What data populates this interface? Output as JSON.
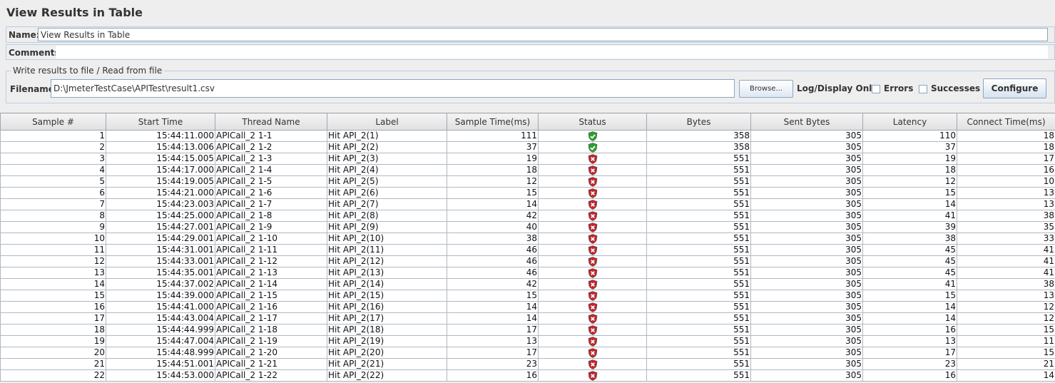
{
  "title": "View Results in Table",
  "name_label": "Name:",
  "name_value": "View Results in Table",
  "comments_label": "Comments:",
  "file_section": {
    "legend": "Write results to file / Read from file",
    "filename_label": "Filename",
    "filename_value": "D:\\JmeterTestCase\\APITest\\result1.csv",
    "browse_label": "Browse...",
    "log_display_label": "Log/Display Only:",
    "errors_label": "Errors",
    "successes_label": "Successes",
    "configure_label": "Configure"
  },
  "table": {
    "columns": [
      "Sample #",
      "Start Time",
      "Thread Name",
      "Label",
      "Sample Time(ms)",
      "Status",
      "Bytes",
      "Sent Bytes",
      "Latency",
      "Connect Time(ms)"
    ],
    "status_colors": {
      "success": "#2e9e2e",
      "error": "#c0272d"
    },
    "rows": [
      {
        "sample": "1",
        "start": "15:44:11.000",
        "thread": "APICall_2 1-1",
        "label": "Hit API_2(1)",
        "time": "111",
        "status": "success",
        "bytes": "358",
        "sent": "305",
        "latency": "110",
        "connect": "18"
      },
      {
        "sample": "2",
        "start": "15:44:13.006",
        "thread": "APICall_2 1-2",
        "label": "Hit API_2(2)",
        "time": "37",
        "status": "success",
        "bytes": "358",
        "sent": "305",
        "latency": "37",
        "connect": "18"
      },
      {
        "sample": "3",
        "start": "15:44:15.005",
        "thread": "APICall_2 1-3",
        "label": "Hit API_2(3)",
        "time": "19",
        "status": "error",
        "bytes": "551",
        "sent": "305",
        "latency": "19",
        "connect": "17"
      },
      {
        "sample": "4",
        "start": "15:44:17.000",
        "thread": "APICall_2 1-4",
        "label": "Hit API_2(4)",
        "time": "18",
        "status": "error",
        "bytes": "551",
        "sent": "305",
        "latency": "18",
        "connect": "16"
      },
      {
        "sample": "5",
        "start": "15:44:19.005",
        "thread": "APICall_2 1-5",
        "label": "Hit API_2(5)",
        "time": "12",
        "status": "error",
        "bytes": "551",
        "sent": "305",
        "latency": "12",
        "connect": "10"
      },
      {
        "sample": "6",
        "start": "15:44:21.000",
        "thread": "APICall_2 1-6",
        "label": "Hit API_2(6)",
        "time": "15",
        "status": "error",
        "bytes": "551",
        "sent": "305",
        "latency": "15",
        "connect": "13"
      },
      {
        "sample": "7",
        "start": "15:44:23.003",
        "thread": "APICall_2 1-7",
        "label": "Hit API_2(7)",
        "time": "14",
        "status": "error",
        "bytes": "551",
        "sent": "305",
        "latency": "14",
        "connect": "13"
      },
      {
        "sample": "8",
        "start": "15:44:25.000",
        "thread": "APICall_2 1-8",
        "label": "Hit API_2(8)",
        "time": "42",
        "status": "error",
        "bytes": "551",
        "sent": "305",
        "latency": "41",
        "connect": "38"
      },
      {
        "sample": "9",
        "start": "15:44:27.001",
        "thread": "APICall_2 1-9",
        "label": "Hit API_2(9)",
        "time": "40",
        "status": "error",
        "bytes": "551",
        "sent": "305",
        "latency": "39",
        "connect": "35"
      },
      {
        "sample": "10",
        "start": "15:44:29.001",
        "thread": "APICall_2 1-10",
        "label": "Hit API_2(10)",
        "time": "38",
        "status": "error",
        "bytes": "551",
        "sent": "305",
        "latency": "38",
        "connect": "33"
      },
      {
        "sample": "11",
        "start": "15:44:31.001",
        "thread": "APICall_2 1-11",
        "label": "Hit API_2(11)",
        "time": "46",
        "status": "error",
        "bytes": "551",
        "sent": "305",
        "latency": "45",
        "connect": "41"
      },
      {
        "sample": "12",
        "start": "15:44:33.001",
        "thread": "APICall_2 1-12",
        "label": "Hit API_2(12)",
        "time": "46",
        "status": "error",
        "bytes": "551",
        "sent": "305",
        "latency": "45",
        "connect": "41"
      },
      {
        "sample": "13",
        "start": "15:44:35.001",
        "thread": "APICall_2 1-13",
        "label": "Hit API_2(13)",
        "time": "46",
        "status": "error",
        "bytes": "551",
        "sent": "305",
        "latency": "45",
        "connect": "41"
      },
      {
        "sample": "14",
        "start": "15:44:37.002",
        "thread": "APICall_2 1-14",
        "label": "Hit API_2(14)",
        "time": "42",
        "status": "error",
        "bytes": "551",
        "sent": "305",
        "latency": "41",
        "connect": "38"
      },
      {
        "sample": "15",
        "start": "15:44:39.000",
        "thread": "APICall_2 1-15",
        "label": "Hit API_2(15)",
        "time": "15",
        "status": "error",
        "bytes": "551",
        "sent": "305",
        "latency": "15",
        "connect": "13"
      },
      {
        "sample": "16",
        "start": "15:44:41.000",
        "thread": "APICall_2 1-16",
        "label": "Hit API_2(16)",
        "time": "14",
        "status": "error",
        "bytes": "551",
        "sent": "305",
        "latency": "14",
        "connect": "12"
      },
      {
        "sample": "17",
        "start": "15:44:43.004",
        "thread": "APICall_2 1-17",
        "label": "Hit API_2(17)",
        "time": "14",
        "status": "error",
        "bytes": "551",
        "sent": "305",
        "latency": "14",
        "connect": "12"
      },
      {
        "sample": "18",
        "start": "15:44:44.999",
        "thread": "APICall_2 1-18",
        "label": "Hit API_2(18)",
        "time": "17",
        "status": "error",
        "bytes": "551",
        "sent": "305",
        "latency": "16",
        "connect": "15"
      },
      {
        "sample": "19",
        "start": "15:44:47.004",
        "thread": "APICall_2 1-19",
        "label": "Hit API_2(19)",
        "time": "13",
        "status": "error",
        "bytes": "551",
        "sent": "305",
        "latency": "13",
        "connect": "11"
      },
      {
        "sample": "20",
        "start": "15:44:48.999",
        "thread": "APICall_2 1-20",
        "label": "Hit API_2(20)",
        "time": "17",
        "status": "error",
        "bytes": "551",
        "sent": "305",
        "latency": "17",
        "connect": "15"
      },
      {
        "sample": "21",
        "start": "15:44:51.001",
        "thread": "APICall_2 1-21",
        "label": "Hit API_2(21)",
        "time": "23",
        "status": "error",
        "bytes": "551",
        "sent": "305",
        "latency": "23",
        "connect": "21"
      },
      {
        "sample": "22",
        "start": "15:44:53.000",
        "thread": "APICall_2 1-22",
        "label": "Hit API_2(22)",
        "time": "16",
        "status": "error",
        "bytes": "551",
        "sent": "305",
        "latency": "16",
        "connect": "14"
      }
    ]
  }
}
